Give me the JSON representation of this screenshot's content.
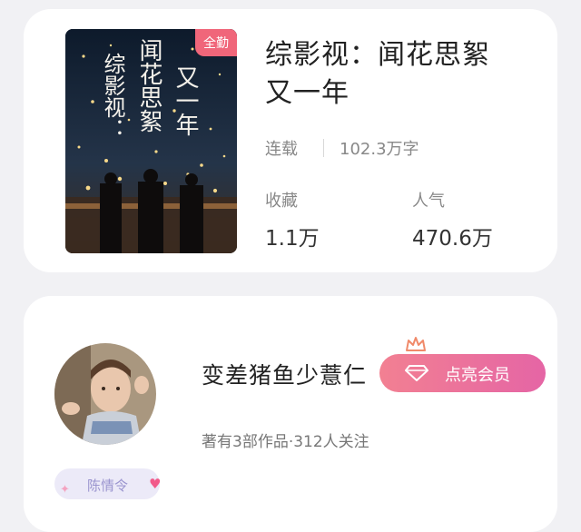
{
  "book": {
    "badge": "全勤",
    "title_line1": "综影视：闻花思絮",
    "title_line2": "又一年",
    "status": "连载",
    "words": "102.3万字",
    "collect_label": "收藏",
    "collect_value": "1.1万",
    "popularity_label": "人气",
    "popularity_value": "470.6万",
    "cover_text_left": "综影视：",
    "cover_text_mid": "闻花思絮",
    "cover_text_right": "又一年"
  },
  "author": {
    "name": "变差猪鱼少薏仁",
    "vip_label": "点亮会员",
    "meta": "著有3部作品·312人关注",
    "tag": "陈情令"
  },
  "colors": {
    "accent": "#f0667a",
    "vip_gradient_start": "#f28092",
    "vip_gradient_end": "#e565a5",
    "tag_bg": "#eceaf8"
  }
}
